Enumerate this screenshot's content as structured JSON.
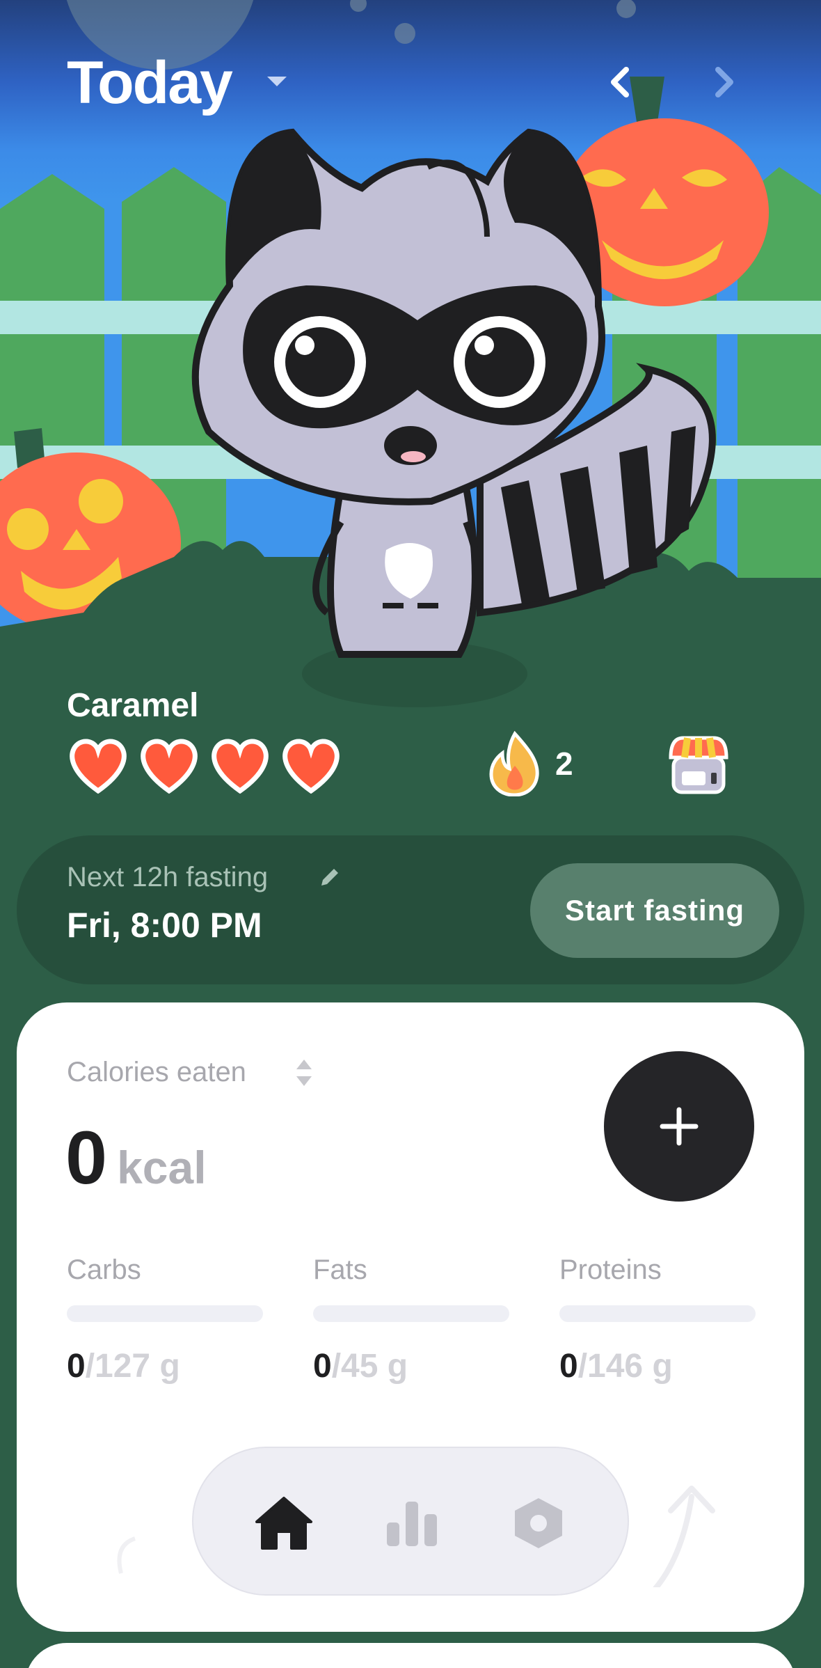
{
  "header": {
    "title": "Today",
    "prev_icon": "chevron-left-icon",
    "next_icon": "chevron-right-icon"
  },
  "pet": {
    "name": "Caramel",
    "hearts": 4,
    "streak_count": "2",
    "streak_icon": "flame-icon",
    "shop_icon": "shop-icon"
  },
  "fasting": {
    "label": "Next 12h fasting",
    "time": "Fri, 8:00 PM",
    "button_label": "Start fasting"
  },
  "calories": {
    "label": "Calories eaten",
    "value": "0",
    "unit": "kcal",
    "add_icon": "plus-icon",
    "macros": [
      {
        "name": "Carbs",
        "current": "0",
        "total": "/127 g",
        "progress": 0
      },
      {
        "name": "Fats",
        "current": "0",
        "total": "/45 g",
        "progress": 0
      },
      {
        "name": "Proteins",
        "current": "0",
        "total": "/146 g",
        "progress": 0
      }
    ]
  },
  "tabbar": {
    "items": [
      "home-icon",
      "stats-icon",
      "settings-icon"
    ],
    "active": "home-icon"
  },
  "colors": {
    "grass": "#2d5e47",
    "card_dark": "#264f3c",
    "button_muted": "#58806d",
    "heart": "#ff5a3c",
    "pumpkin": "#ff6b4f",
    "add_button": "#252528"
  }
}
